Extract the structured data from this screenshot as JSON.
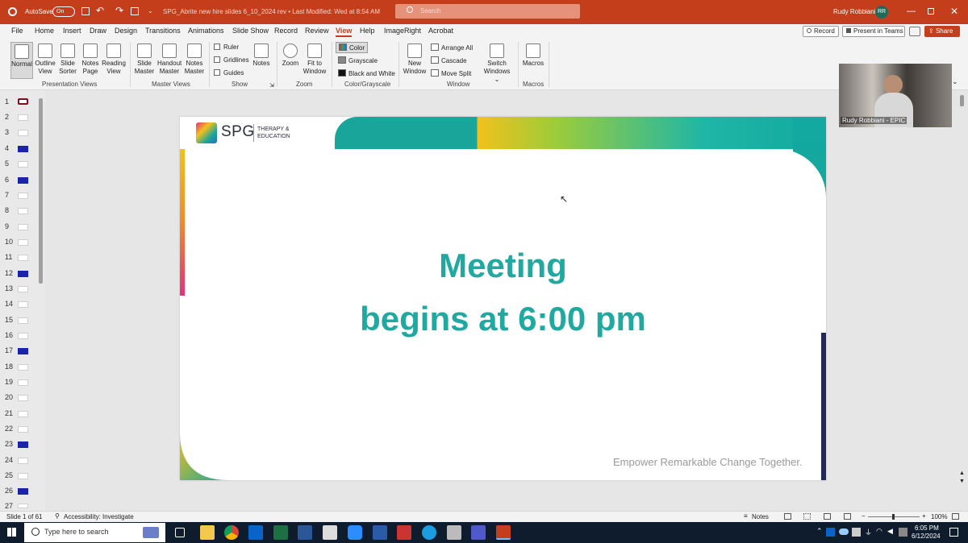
{
  "titlebar": {
    "autosave_label": "AutoSave",
    "autosave_state": "On",
    "document_title": "SPG_Abrite new hire slides 6_10_2024 rev • Last Modified: Wed at 8:54 AM",
    "search_placeholder": "Search",
    "user_name": "Rudy Robbiani",
    "user_initials": "RR"
  },
  "ribbon_tabs": [
    "File",
    "Home",
    "Insert",
    "Draw",
    "Design",
    "Transitions",
    "Animations",
    "Slide Show",
    "Record",
    "Review",
    "View",
    "Help",
    "ImageRight",
    "Acrobat"
  ],
  "active_tab": "View",
  "ribbon_actions": {
    "record": "Record",
    "present": "Present in Teams",
    "share": "Share"
  },
  "ribbon": {
    "presentation_views": {
      "label": "Presentation Views",
      "normal": "Normal",
      "outline": "Outline View",
      "sorter": "Slide Sorter",
      "notes_page": "Notes Page",
      "reading": "Reading View"
    },
    "master_views": {
      "label": "Master Views",
      "slide_master": "Slide Master",
      "handout_master": "Handout Master",
      "notes_master": "Notes Master"
    },
    "show": {
      "label": "Show",
      "ruler": "Ruler",
      "gridlines": "Gridlines",
      "guides": "Guides",
      "notes": "Notes"
    },
    "zoom": {
      "label": "Zoom",
      "zoom": "Zoom",
      "fit": "Fit to Window"
    },
    "color": {
      "label": "Color/Grayscale",
      "color": "Color",
      "grayscale": "Grayscale",
      "bw": "Black and White"
    },
    "window": {
      "label": "Window",
      "new": "New Window",
      "arrange": "Arrange All",
      "cascade": "Cascade",
      "move_split": "Move Split",
      "switch": "Switch Windows"
    },
    "macros": {
      "label": "Macros",
      "macros": "Macros"
    }
  },
  "video": {
    "caption": "Rudy Robbiani - EPIC"
  },
  "slide_numbers": [
    "1",
    "2",
    "3",
    "4",
    "5",
    "6",
    "7",
    "8",
    "9",
    "10",
    "11",
    "12",
    "13",
    "14",
    "15",
    "16",
    "17",
    "18",
    "19",
    "20",
    "21",
    "22",
    "23",
    "24",
    "25",
    "26",
    "27"
  ],
  "slide": {
    "logo_text": "SPG",
    "logo_sub": "THERAPY & EDUCATION",
    "title_line1": "Meeting",
    "title_line2": "begins at 6:00 pm",
    "tagline": "Empower Remarkable Change Together.",
    "colors": {
      "teal": "#1fa9a0",
      "yellow": "#f2c11b",
      "pink": "#e0327a",
      "navy": "#1f2b55"
    }
  },
  "statusbar": {
    "slide_info": "Slide 1 of 61",
    "accessibility": "Accessibility: Investigate",
    "notes": "Notes",
    "zoom": "100%"
  },
  "taskbar": {
    "search_placeholder": "Type here to search",
    "time": "6:05 PM",
    "date": "6/12/2024"
  }
}
